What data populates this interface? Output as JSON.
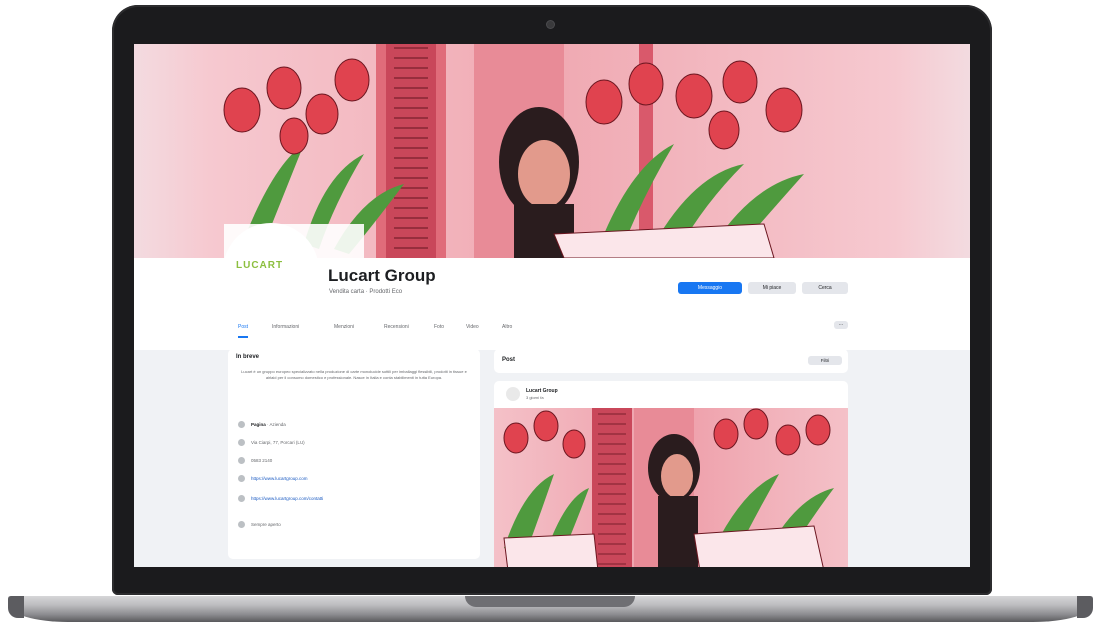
{
  "page": {
    "name": "Lucart Group",
    "subtitle": "Vendita carta · Prodotti Eco",
    "logo_text": "LUCART",
    "buttons": {
      "primary": "Messaggio",
      "like": "Mi piace",
      "search": "Cerca"
    },
    "tabs": [
      "Post",
      "Informazioni",
      "Menzioni",
      "Recensioni",
      "Foto",
      "Video",
      "Altro"
    ],
    "active_tab": "Post",
    "more_label": "···"
  },
  "intro": {
    "title": "In breve",
    "description": "Lucart è un gruppo europeo specializzato nella produzione di carte monolucide sottili per imballaggi flessibili, prodotti in tissue e airlaid per il consumo domestico e professionale. Nasce in Italia e conta stabilimenti in tutta Europa.",
    "category_label": "Pagina",
    "category_value": "· Azienda",
    "address": "Via Ciarpi, 77, Porcari (LU)",
    "phone": "0583 2140",
    "website": "https://www.lucartgroup.com",
    "email_link": "https://www.lucartgroup.com/contatti",
    "extra": "Sempre aperto"
  },
  "feed": {
    "title": "Post",
    "filter_label": "Filtri",
    "post": {
      "author": "Lucart Group",
      "meta": "3 giorni fa"
    }
  },
  "colors": {
    "cover_pink": "#f0a9b2",
    "tulip_red": "#e0434f",
    "leaf_green": "#4f9a3e",
    "facebook_blue": "#1877f2",
    "logo_green": "#8cbf3f"
  },
  "icons": [
    "camera-icon",
    "info-icon",
    "location-icon",
    "phone-icon",
    "globe-icon",
    "link-icon",
    "clock-icon",
    "more-icon"
  ]
}
